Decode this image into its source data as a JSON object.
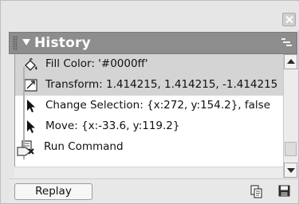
{
  "panel": {
    "title": "History"
  },
  "history": {
    "items": [
      {
        "label": "Fill Color: '#0000ff'",
        "icon": "fill-color-icon",
        "selected": true
      },
      {
        "label": "Transform: 1.414215, 1.414215, -1.414215",
        "icon": "transform-icon",
        "selected": true
      },
      {
        "label": "Change Selection: {x:272, y:154.2}, false",
        "icon": "arrow-pointer-icon",
        "selected": false
      },
      {
        "label": "Move: {x:-33.6, y:119.2}",
        "icon": "arrow-pointer-icon",
        "selected": false
      },
      {
        "label": "Run Command",
        "icon": "run-command-icon",
        "selected": false
      }
    ]
  },
  "footer": {
    "replay_label": "Replay",
    "copy_icon": "copy-steps-icon",
    "save_icon": "save-as-command-icon"
  },
  "colors": {
    "header_bg": "#8d8d8d",
    "selected_row_bg": "#d4d4d4",
    "list_bg": "#ffffff"
  }
}
